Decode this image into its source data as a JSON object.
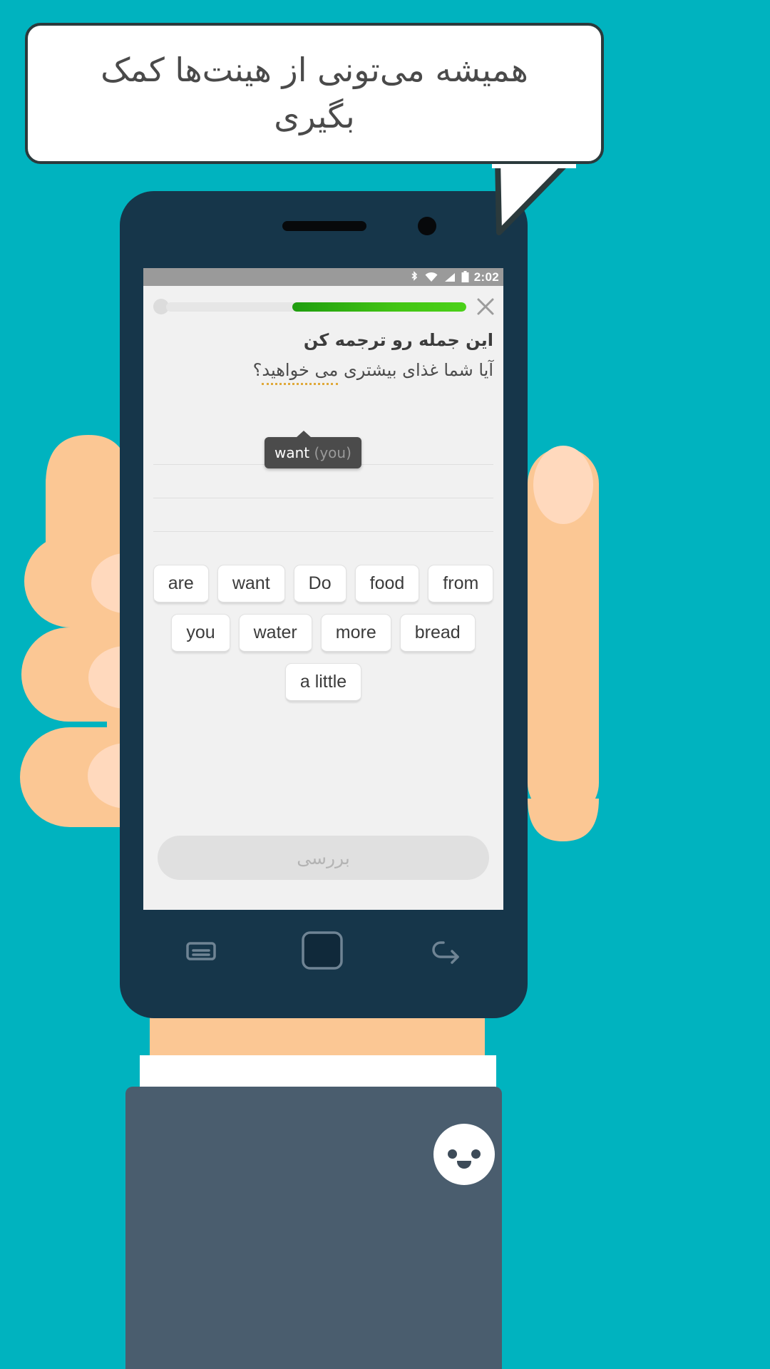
{
  "theme": {
    "background": "#00b3bf",
    "phone_body": "#16364a",
    "screen_bg": "#f1f1f1",
    "progress_green": "#43c514",
    "hint_underline": "#e0a93b",
    "tooltip_bg": "#4b4b4b",
    "skin": "#fbc794"
  },
  "speech_bubble": {
    "text": "همیشه می‌تونی از هینت‌ها کمک بگیری"
  },
  "status_bar": {
    "time": "2:02",
    "icons": [
      "bluetooth-icon",
      "wifi-icon",
      "signal-icon",
      "battery-icon"
    ]
  },
  "lesson": {
    "progress_percent": 58,
    "close_label": "×",
    "prompt": "این جمله رو ترجمه کن",
    "sentence": {
      "full": "آیا شما غذای بیشتری می خواهید؟",
      "segments": [
        {
          "text": "آیا شما غذای بیشتری ",
          "hint": false
        },
        {
          "text": "می خواهید",
          "hint": true
        },
        {
          "text": "؟",
          "hint": false
        }
      ]
    },
    "tooltip": {
      "muted": "(you)",
      "main": "want"
    },
    "answer_line_count": 4,
    "word_bank_rows": [
      [
        "are",
        "want",
        "Do",
        "food",
        "from"
      ],
      [
        "you",
        "water",
        "more",
        "bread"
      ],
      [
        "a little"
      ]
    ],
    "check_button_label": "بررسی"
  },
  "nav_bar": {
    "items": [
      "recents-icon",
      "home-icon",
      "back-icon"
    ]
  }
}
